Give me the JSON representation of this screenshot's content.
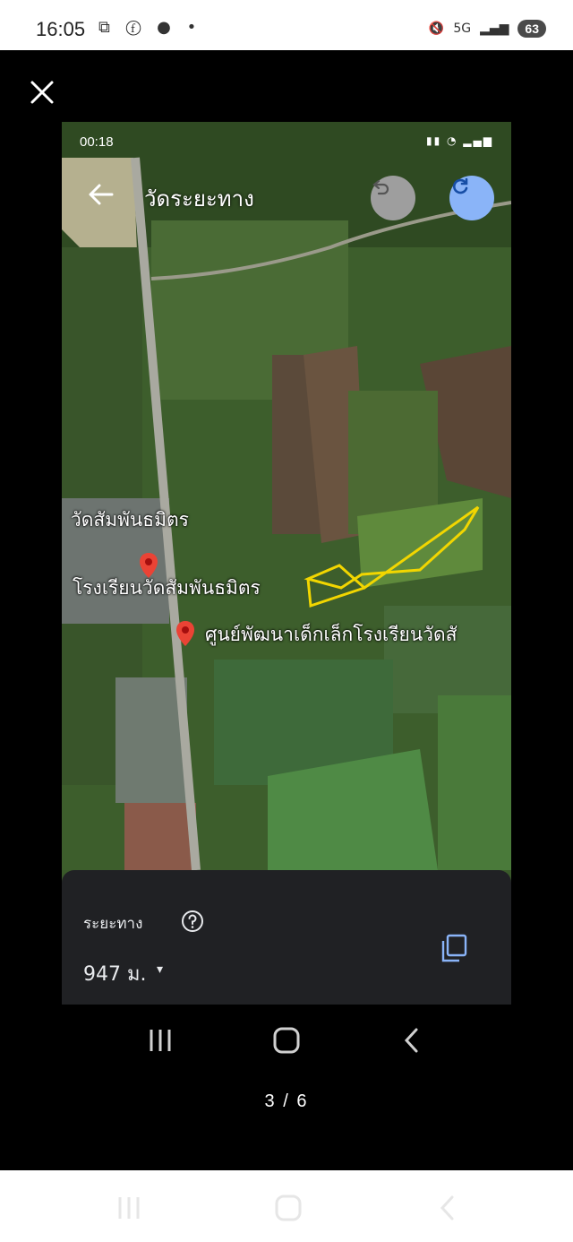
{
  "status_bar": {
    "time": "16:05",
    "network": "5G",
    "battery": "63",
    "left_icons": [
      "screenshot-icon",
      "facebook-icon",
      "chat-icon",
      "dot"
    ],
    "right_icons": [
      "mute-icon",
      "5g-icon",
      "signal-icon",
      "battery-icon"
    ]
  },
  "viewer": {
    "counter": "3 / 6",
    "close_icon": "close-icon"
  },
  "photo": {
    "inner_status": {
      "time": "00:18"
    },
    "header": {
      "title": "วัดระยะทาง"
    },
    "map_labels": {
      "temple": "วัดสัมพันธมิตร",
      "school": "โรงเรียนวัดสัมพันธมิตร",
      "childcare": "ศูนย์พัฒนาเด็กเล็กโรงเรียนวัดสั"
    },
    "sheet": {
      "label": "ระยะทาง",
      "distance": "947 ม.",
      "caret": "▾"
    }
  },
  "colors": {
    "accent_blue": "#8ab4f8",
    "measure_line": "#f2d600",
    "pin_red": "#ea4335",
    "sheet_bg": "#202124"
  }
}
